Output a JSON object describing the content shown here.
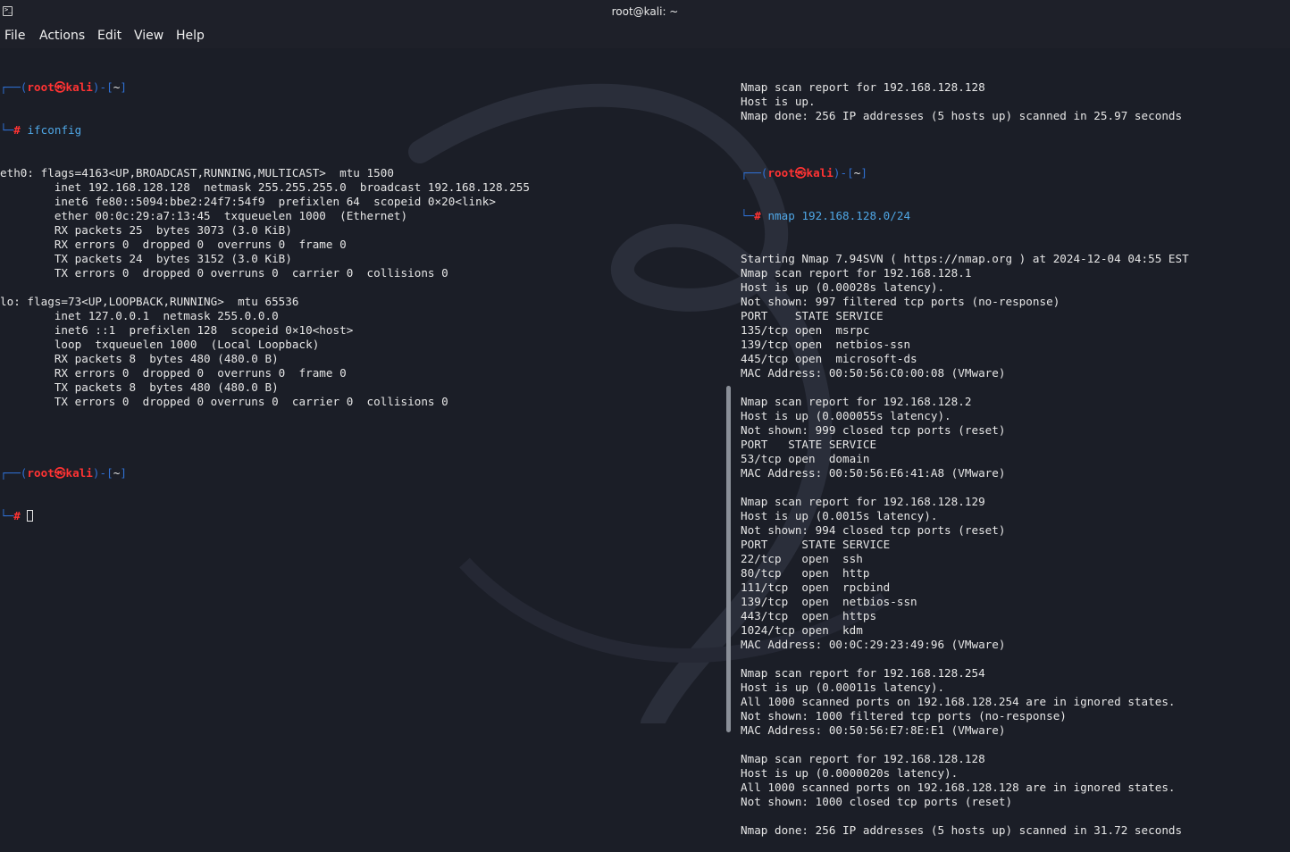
{
  "window": {
    "title": "root@kali: ~"
  },
  "menu": [
    "File",
    "Actions",
    "Edit",
    "View",
    "Help"
  ],
  "prompt": {
    "open": "┌──(",
    "user": "root",
    "at": "㉿",
    "host": "kali",
    "mid": ")-[",
    "dir": "~",
    "close": "]",
    "second": "└─",
    "hash": "#"
  },
  "left": {
    "cmd1": "ifconfig",
    "output": [
      "eth0: flags=4163<UP,BROADCAST,RUNNING,MULTICAST>  mtu 1500",
      "        inet 192.168.128.128  netmask 255.255.255.0  broadcast 192.168.128.255",
      "        inet6 fe80::5094:bbe2:24f7:54f9  prefixlen 64  scopeid 0×20<link>",
      "        ether 00:0c:29:a7:13:45  txqueuelen 1000  (Ethernet)",
      "        RX packets 25  bytes 3073 (3.0 KiB)",
      "        RX errors 0  dropped 0  overruns 0  frame 0",
      "        TX packets 24  bytes 3152 (3.0 KiB)",
      "        TX errors 0  dropped 0 overruns 0  carrier 0  collisions 0",
      "",
      "lo: flags=73<UP,LOOPBACK,RUNNING>  mtu 65536",
      "        inet 127.0.0.1  netmask 255.0.0.0",
      "        inet6 ::1  prefixlen 128  scopeid 0×10<host>",
      "        loop  txqueuelen 1000  (Local Loopback)",
      "        RX packets 8  bytes 480 (480.0 B)",
      "        RX errors 0  dropped 0  overruns 0  frame 0",
      "        TX packets 8  bytes 480 (480.0 B)",
      "        TX errors 0  dropped 0 overruns 0  carrier 0  collisions 0",
      "",
      ""
    ]
  },
  "right": {
    "pre": [
      "Nmap scan report for 192.168.128.128",
      "Host is up.",
      "Nmap done: 256 IP addresses (5 hosts up) scanned in 25.97 seconds",
      ""
    ],
    "cmd": "nmap 192.168.128.0/24",
    "output": [
      "Starting Nmap 7.94SVN ( https://nmap.org ) at 2024-12-04 04:55 EST",
      "Nmap scan report for 192.168.128.1",
      "Host is up (0.00028s latency).",
      "Not shown: 997 filtered tcp ports (no-response)",
      "PORT    STATE SERVICE",
      "135/tcp open  msrpc",
      "139/tcp open  netbios-ssn",
      "445/tcp open  microsoft-ds",
      "MAC Address: 00:50:56:C0:00:08 (VMware)",
      "",
      "Nmap scan report for 192.168.128.2",
      "Host is up (0.000055s latency).",
      "Not shown: 999 closed tcp ports (reset)",
      "PORT   STATE SERVICE",
      "53/tcp open  domain",
      "MAC Address: 00:50:56:E6:41:A8 (VMware)",
      "",
      "Nmap scan report for 192.168.128.129",
      "Host is up (0.0015s latency).",
      "Not shown: 994 closed tcp ports (reset)",
      "PORT     STATE SERVICE",
      "22/tcp   open  ssh",
      "80/tcp   open  http",
      "111/tcp  open  rpcbind",
      "139/tcp  open  netbios-ssn",
      "443/tcp  open  https",
      "1024/tcp open  kdm",
      "MAC Address: 00:0C:29:23:49:96 (VMware)",
      "",
      "Nmap scan report for 192.168.128.254",
      "Host is up (0.00011s latency).",
      "All 1000 scanned ports on 192.168.128.254 are in ignored states.",
      "Not shown: 1000 filtered tcp ports (no-response)",
      "MAC Address: 00:50:56:E7:8E:E1 (VMware)",
      "",
      "Nmap scan report for 192.168.128.128",
      "Host is up (0.0000020s latency).",
      "All 1000 scanned ports on 192.168.128.128 are in ignored states.",
      "Not shown: 1000 closed tcp ports (reset)",
      "",
      "Nmap done: 256 IP addresses (5 hosts up) scanned in 31.72 seconds"
    ]
  }
}
